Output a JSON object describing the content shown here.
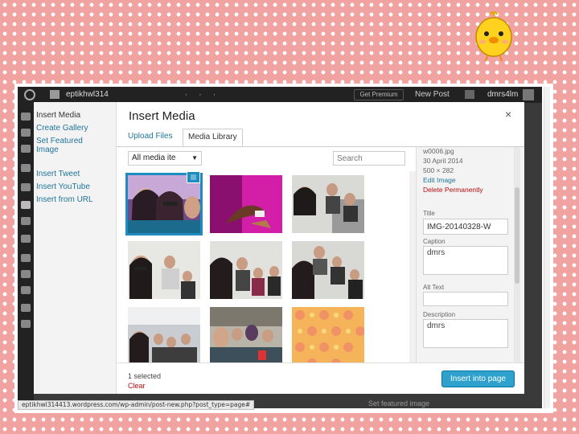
{
  "adminbar": {
    "site_name": "eptikhwl314",
    "premium_label": "Get Premium",
    "new_post_label": "New Post",
    "user_name": "dmrs4lm"
  },
  "menu": {
    "items": [
      "Insert Media",
      "Create Gallery",
      "Set Featured Image",
      "Insert Tweet",
      "Insert YouTube",
      "Insert from URL"
    ]
  },
  "modal": {
    "title": "Insert Media",
    "close_label": "×",
    "tabs": [
      "Upload Files",
      "Media Library"
    ],
    "active_tab": "Media Library"
  },
  "toolbar": {
    "filter_value": "All media ite",
    "search_placeholder": "Search"
  },
  "details": {
    "filename": "w0006.jpg",
    "date": "30 April 2014",
    "dimensions": "500 × 282",
    "edit_image_label": "Edit Image",
    "delete_label": "Delete Permanently",
    "title_label": "Title",
    "title_value": "IMG-20140328-W",
    "caption_label": "Caption",
    "caption_value": "dmrs",
    "alt_label": "Alt Text",
    "alt_value": "",
    "description_label": "Description",
    "description_value": "dmrs"
  },
  "footer": {
    "selected_count": "1 selected",
    "clear_label": "Clear",
    "insert_label": "Insert into page"
  },
  "background": {
    "featured_label": "Set featured image",
    "status_url": "eptikhwl314413.wordpress.com/wp-admin/post-new.php?post_type=page#"
  },
  "colors": {
    "accent": "#1e8cbe",
    "button": "#2ea2cc",
    "link": "#21759b",
    "danger": "#bc0b0b",
    "slide_background": "#f0a3a0"
  },
  "thumbnails": [
    {
      "name": "selfie-girls-pink",
      "selected": true
    },
    {
      "name": "hand-pink-wall",
      "selected": false
    },
    {
      "name": "group-selfie-classroom",
      "selected": false
    },
    {
      "name": "friends-group-1",
      "selected": false
    },
    {
      "name": "friends-group-2",
      "selected": false
    },
    {
      "name": "friends-group-3",
      "selected": false
    },
    {
      "name": "friends-room",
      "selected": false
    },
    {
      "name": "friends-cafe",
      "selected": false
    },
    {
      "name": "orange-pattern",
      "selected": false
    }
  ]
}
